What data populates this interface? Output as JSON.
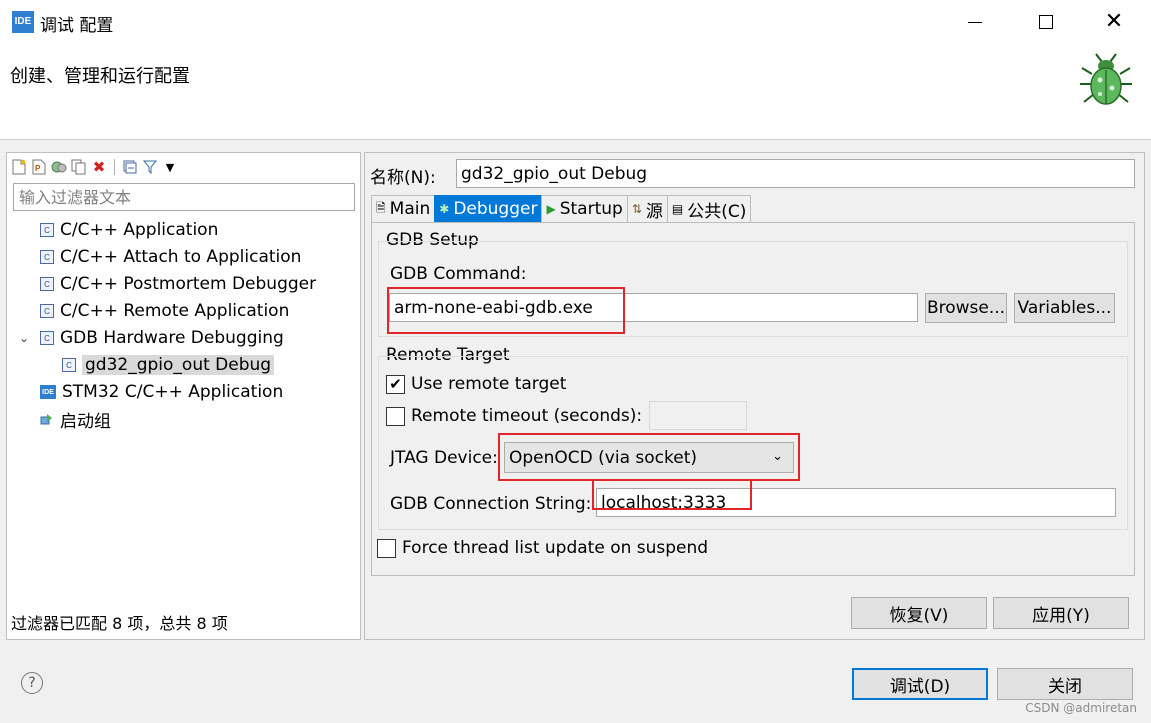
{
  "window": {
    "app_icon_text": "IDE",
    "title": "调试 配置",
    "header_title": "创建、管理和运行配置"
  },
  "left": {
    "toolbar_icons": [
      "new-configuration-icon",
      "new-prototype-icon",
      "export-icon",
      "duplicate-icon",
      "delete-icon",
      "collapse-all-icon",
      "filter-icon",
      "view-menu-icon"
    ],
    "filter_placeholder": "输入过滤器文本",
    "tree": [
      {
        "label": "C/C++ Application",
        "icon": "c-app-icon",
        "level": 0,
        "expanded": false
      },
      {
        "label": "C/C++ Attach to Application",
        "icon": "c-app-icon",
        "level": 0,
        "expanded": false
      },
      {
        "label": "C/C++ Postmortem Debugger",
        "icon": "c-app-icon",
        "level": 0,
        "expanded": false
      },
      {
        "label": "C/C++ Remote Application",
        "icon": "c-app-icon",
        "level": 0,
        "expanded": false
      },
      {
        "label": "GDB Hardware Debugging",
        "icon": "c-app-icon",
        "level": 0,
        "expanded": true
      },
      {
        "label": "gd32_gpio_out Debug",
        "icon": "c-app-icon",
        "level": 1,
        "selected": true
      },
      {
        "label": "STM32 C/C++ Application",
        "icon": "ide-icon",
        "level": 0,
        "expanded": false
      },
      {
        "label": "启动组",
        "icon": "launch-group-icon",
        "level": 0,
        "expanded": false
      }
    ],
    "status": "过滤器已匹配 8 项，总共 8 项"
  },
  "right": {
    "name_label": "名称(N):",
    "name_value": "gd32_gpio_out Debug",
    "tabs": [
      {
        "label": "Main",
        "icon": "main-tab-icon",
        "active": false
      },
      {
        "label": "Debugger",
        "icon": "debugger-tab-icon",
        "active": true
      },
      {
        "label": "Startup",
        "icon": "startup-tab-icon",
        "active": false
      },
      {
        "label": "源",
        "icon": "source-tab-icon",
        "active": false
      },
      {
        "label": "公共(C)",
        "icon": "common-tab-icon",
        "active": false
      }
    ],
    "gdb_setup": {
      "title": "GDB Setup",
      "command_label": "GDB Command:",
      "command_value": "arm-none-eabi-gdb.exe",
      "browse_label": "Browse...",
      "variables_label": "Variables..."
    },
    "remote_target": {
      "title": "Remote Target",
      "use_remote_label": "Use remote target",
      "use_remote_checked": true,
      "remote_timeout_label": "Remote timeout (seconds):",
      "remote_timeout_checked": false,
      "remote_timeout_value": "",
      "jtag_label": "JTAG Device:",
      "jtag_value": "OpenOCD (via socket)",
      "connection_label": "GDB Connection String:",
      "connection_value": "localhost:3333"
    },
    "force_thread_label": "Force thread list update on suspend",
    "force_thread_checked": false,
    "revert_label": "恢复(V)",
    "apply_label": "应用(Y)"
  },
  "footer": {
    "debug_label": "调试(D)",
    "close_label": "关闭",
    "watermark": "CSDN @admiretan"
  },
  "colors": {
    "accent": "#0078d7",
    "highlight_border": "#e0262b"
  }
}
